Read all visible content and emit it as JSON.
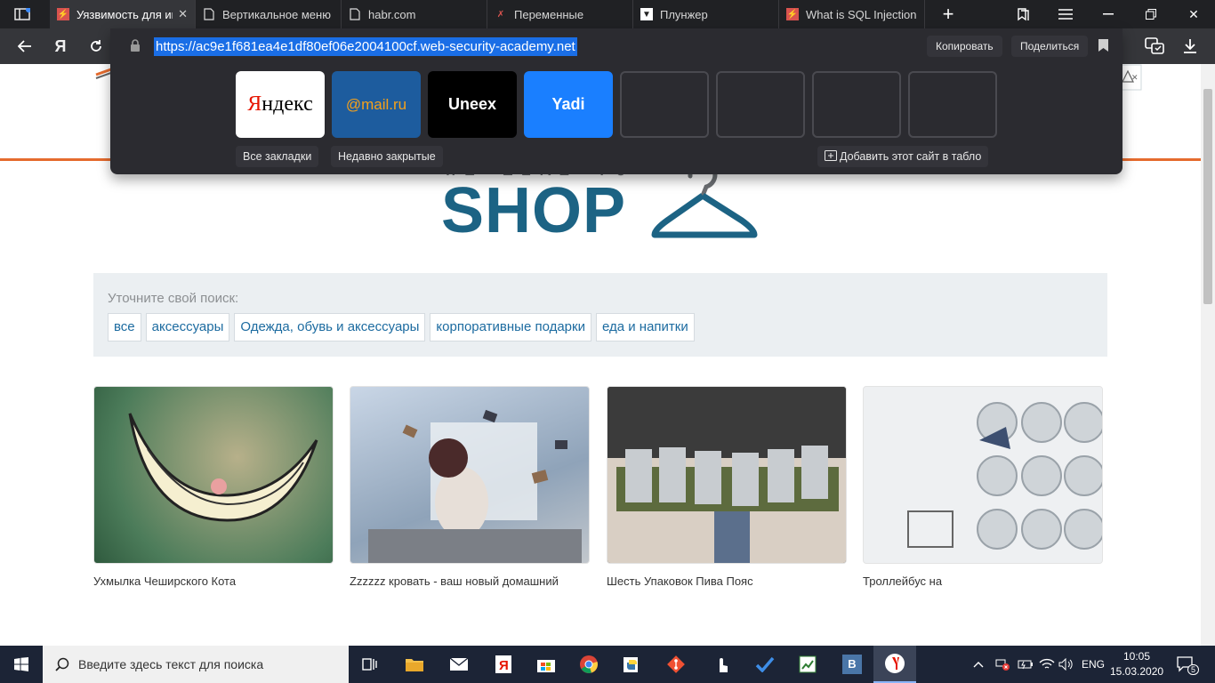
{
  "browser": {
    "tabs": [
      {
        "label": "Уязвимость для инъекции SQL",
        "active": true,
        "favicon": "portswigger-icon"
      },
      {
        "label": "Вертикальное меню",
        "active": false,
        "favicon": "page-icon"
      },
      {
        "label": "habr.com",
        "active": false,
        "favicon": "page-icon"
      },
      {
        "label": "Переменные",
        "active": false,
        "favicon": "portswigger-icon"
      },
      {
        "label": "Плунжер",
        "active": false,
        "favicon": "plunker-icon"
      },
      {
        "label": "What is SQL Injection",
        "active": false,
        "favicon": "portswigger-icon"
      }
    ],
    "toolbar": {
      "yandex_logo": "Я"
    },
    "address": {
      "url": "https://ac9e1f681ea4e1df80ef06e2004100cf.web-security-academy.net",
      "copy_label": "Копировать",
      "share_label": "Поделиться"
    },
    "tiles": [
      {
        "label": "Яндекс"
      },
      {
        "label": "@mail.ru"
      },
      {
        "label": "Uneex"
      },
      {
        "label": "Yadi"
      }
    ],
    "chips": {
      "all_bookmarks": "Все закладки",
      "recently_closed": "Недавно закрытые",
      "add_site": "Добавить этот сайт в табло"
    }
  },
  "page": {
    "logo_top": "WE LIKE TO",
    "logo_main": "SHOP",
    "filter": {
      "title": "Уточните свой поиск:",
      "items": [
        "все",
        "аксессуары",
        "Одежда, обувь и аксессуары",
        "корпоративные подарки",
        "еда и напитки"
      ]
    },
    "products": [
      {
        "name": "Ухмылка Чеширского Кота"
      },
      {
        "name": "Zzzzzz кровать - ваш новый домашний"
      },
      {
        "name": "Шесть Упаковок Пива Пояс"
      },
      {
        "name": "Троллейбус на"
      }
    ]
  },
  "taskbar": {
    "search_placeholder": "Введите здесь текст для поиска",
    "language": "ENG",
    "time": "10:05",
    "date": "15.03.2020",
    "notifications": "5",
    "vk_label": "В"
  },
  "colors": {
    "accent": "#1a6ee6",
    "shop_blue": "#1c6384",
    "orange": "#e56b2e"
  }
}
